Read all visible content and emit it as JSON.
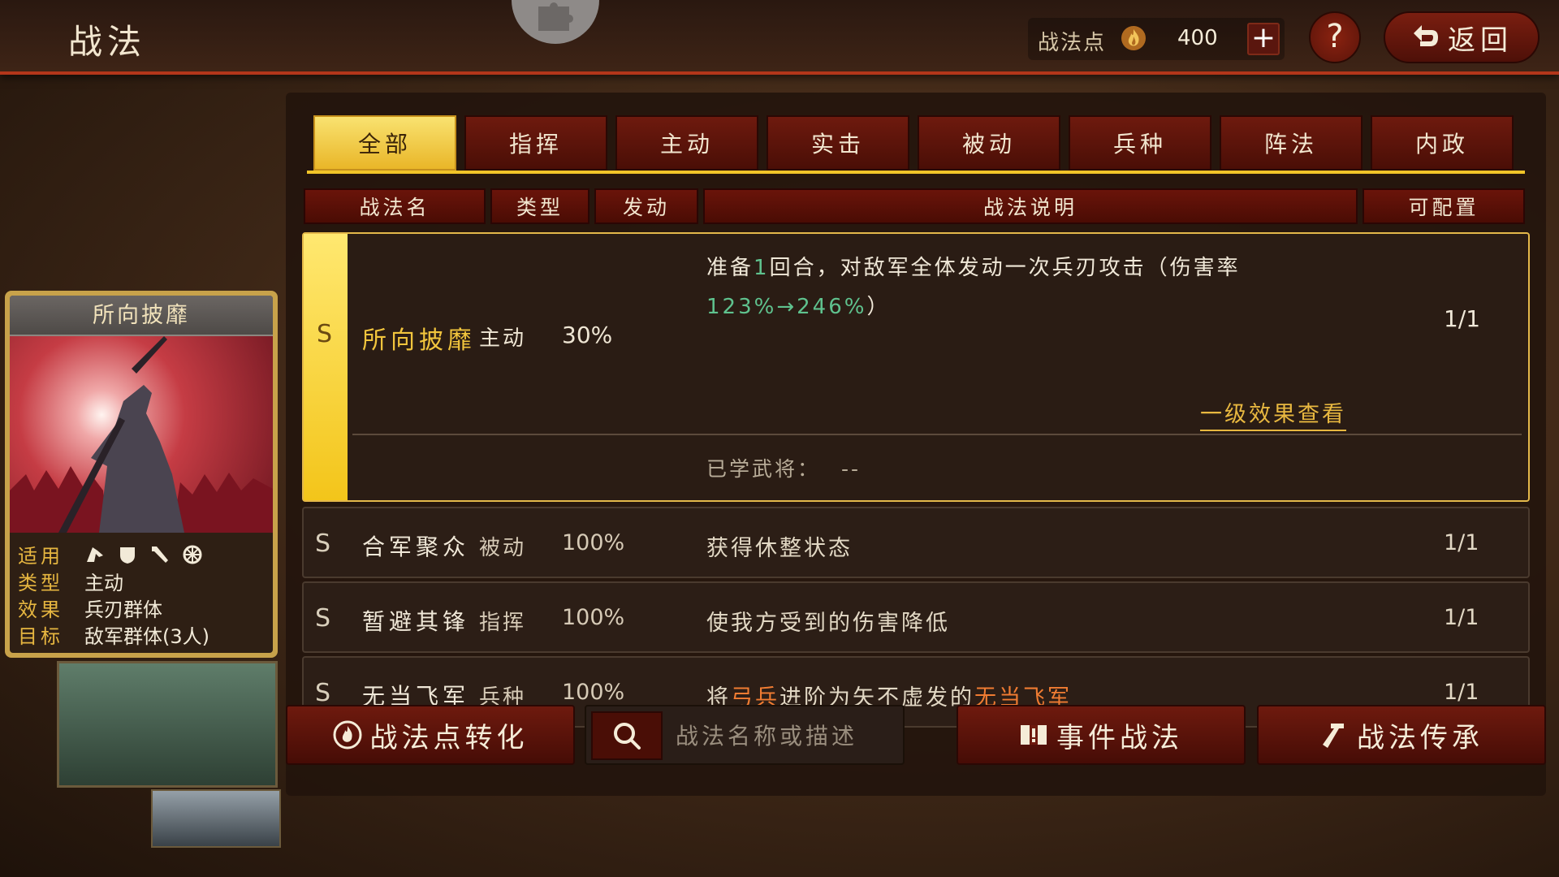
{
  "header": {
    "title": "战法",
    "points_label": "战法点",
    "points_value": "400",
    "plus": "+",
    "help": "?",
    "back_label": "返回"
  },
  "tabs": [
    {
      "label": "全部",
      "active": true
    },
    {
      "label": "指挥"
    },
    {
      "label": "主动"
    },
    {
      "label": "实击"
    },
    {
      "label": "被动"
    },
    {
      "label": "兵种"
    },
    {
      "label": "阵法"
    },
    {
      "label": "内政"
    }
  ],
  "columns": [
    "战法名",
    "类型",
    "发动",
    "战法说明",
    "可配置"
  ],
  "selected": {
    "grade": "S",
    "name": "所向披靡",
    "type": "主动",
    "rate": "30%",
    "desc_line1": "准备",
    "desc_num": "1",
    "desc_line1b": "回合，对敌军全体发动一次兵刃攻击（伤害率",
    "desc_rate": "123%→246%",
    "desc_close": "）",
    "slot": "1/1",
    "view_link": "一级效果查看",
    "learned_label": "已学武将：",
    "learned_value": "--"
  },
  "rows": [
    {
      "grade": "S",
      "name": "合军聚众",
      "type": "被动",
      "rate": "100%",
      "desc": "获得休整状态",
      "slot": "1/1"
    },
    {
      "grade": "S",
      "name": "暂避其锋",
      "type": "指挥",
      "rate": "100%",
      "desc": "使我方受到的伤害降低",
      "slot": "1/1"
    },
    {
      "grade": "S",
      "name": "无当飞军",
      "type": "兵种",
      "rate": "100%",
      "desc_a": "将",
      "desc_b": "弓兵",
      "desc_c": "进阶为矢不虚发的",
      "desc_d": "无当飞军",
      "slot": "1/1"
    }
  ],
  "card": {
    "title": "所向披靡",
    "applicable_label": "适用",
    "type_label": "类型",
    "type_value": "主动",
    "effect_label": "效果",
    "effect_value": "兵刃群体",
    "target_label": "目标",
    "target_value": "敌军群体(3人)",
    "unit_icons": [
      "cavalry-icon",
      "shield-icon",
      "bow-icon",
      "wheel-icon"
    ]
  },
  "bottom": {
    "convert_label": "战法点转化",
    "search_placeholder": "战法名称或描述",
    "event_label": "事件战法",
    "inherit_label": "战法传承"
  },
  "colors": {
    "accent_gold": "#f2c53d",
    "tab_active": "#f3c51a",
    "button_red": "#6e1a0e",
    "highlight_green": "#5fc28e",
    "highlight_orange": "#f07c32"
  }
}
